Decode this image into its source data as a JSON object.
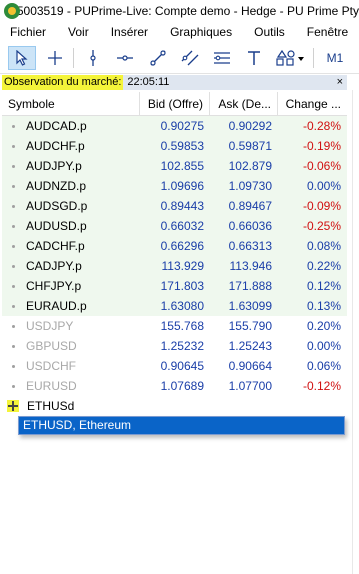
{
  "window": {
    "title": "5003519 - PUPrime-Live: Compte demo - Hedge - PU Prime Pty"
  },
  "menu": [
    "Fichier",
    "Voir",
    "Insérer",
    "Graphiques",
    "Outils",
    "Fenêtre"
  ],
  "toolbar": {
    "timeframe": "M1",
    "icons": [
      "cursor-arrow",
      "crosshair",
      "vertical-line",
      "horizontal-line",
      "trend-line",
      "channel",
      "text",
      "shapes"
    ]
  },
  "market_watch": {
    "title": "Observation du marché:",
    "time": "22:05:11",
    "close": "×",
    "columns": [
      "Symbole",
      "Bid (Offre)",
      "Ask (De...",
      "Change ..."
    ],
    "rows": [
      {
        "symbol": "AUDCAD.p",
        "bid": "0.90275",
        "ask": "0.90292",
        "change": "-0.28%",
        "active": true,
        "dir": "neg"
      },
      {
        "symbol": "AUDCHF.p",
        "bid": "0.59853",
        "ask": "0.59871",
        "change": "-0.19%",
        "active": true,
        "dir": "neg"
      },
      {
        "symbol": "AUDJPY.p",
        "bid": "102.855",
        "ask": "102.879",
        "change": "-0.06%",
        "active": true,
        "dir": "neg"
      },
      {
        "symbol": "AUDNZD.p",
        "bid": "1.09696",
        "ask": "1.09730",
        "change": "0.00%",
        "active": true,
        "dir": "pos"
      },
      {
        "symbol": "AUDSGD.p",
        "bid": "0.89443",
        "ask": "0.89467",
        "change": "-0.09%",
        "active": true,
        "dir": "neg"
      },
      {
        "symbol": "AUDUSD.p",
        "bid": "0.66032",
        "ask": "0.66036",
        "change": "-0.25%",
        "active": true,
        "dir": "neg"
      },
      {
        "symbol": "CADCHF.p",
        "bid": "0.66296",
        "ask": "0.66313",
        "change": "0.08%",
        "active": true,
        "dir": "pos"
      },
      {
        "symbol": "CADJPY.p",
        "bid": "113.929",
        "ask": "113.946",
        "change": "0.22%",
        "active": true,
        "dir": "pos"
      },
      {
        "symbol": "CHFJPY.p",
        "bid": "171.803",
        "ask": "171.888",
        "change": "0.12%",
        "active": true,
        "dir": "pos"
      },
      {
        "symbol": "EURAUD.p",
        "bid": "1.63080",
        "ask": "1.63099",
        "change": "0.13%",
        "active": true,
        "dir": "pos"
      },
      {
        "symbol": "USDJPY",
        "bid": "155.768",
        "ask": "155.790",
        "change": "0.20%",
        "active": false,
        "dir": "pos"
      },
      {
        "symbol": "GBPUSD",
        "bid": "1.25232",
        "ask": "1.25243",
        "change": "0.00%",
        "active": false,
        "dir": "pos"
      },
      {
        "symbol": "USDCHF",
        "bid": "0.90645",
        "ask": "0.90664",
        "change": "0.06%",
        "active": false,
        "dir": "pos"
      },
      {
        "symbol": "EURUSD",
        "bid": "1.07689",
        "ask": "1.07700",
        "change": "-0.12%",
        "active": false,
        "dir": "neg"
      }
    ],
    "add_symbol_value": "ETHUSd",
    "suggestion": "ETHUSD, Ethereum"
  },
  "colors": {
    "active_row_bg": "#eff8ee",
    "price_blue": "#1a3ea8",
    "negative_red": "#d01010",
    "highlight_yellow": "#f4f43a",
    "selection_blue": "#0a64c8"
  }
}
